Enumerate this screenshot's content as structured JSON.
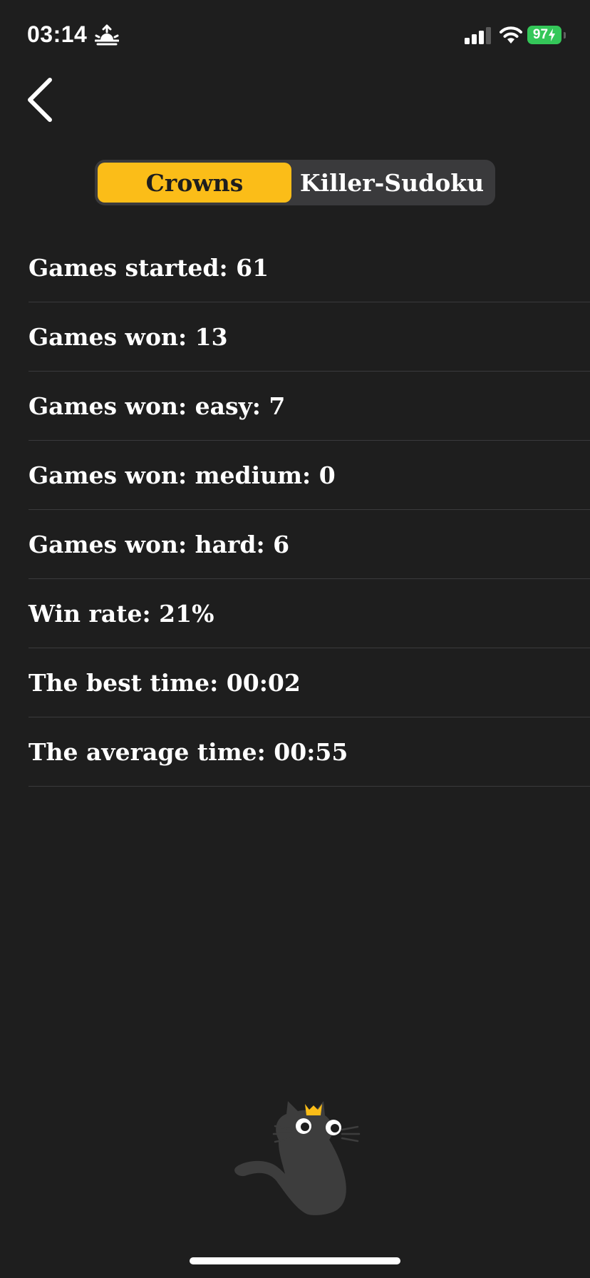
{
  "status_bar": {
    "time": "03:14",
    "battery": "97"
  },
  "tabs": [
    {
      "label": "Crowns",
      "active": true
    },
    {
      "label": "Killer-Sudoku",
      "active": false
    }
  ],
  "stats": [
    "Games started: 61",
    "Games won: 13",
    "Games won: easy: 7",
    "Games won: medium: 0",
    "Games won: hard: 6",
    "Win rate: 21%",
    "The best time: 00:02",
    "The average time: 00:55"
  ],
  "icons": {
    "status_extra": "sunrise-icon",
    "signal": "signal-icon",
    "wifi": "wifi-icon",
    "battery": "battery-charging-icon",
    "back": "chevron-left-icon",
    "mascot": "cat-with-crown-icon"
  },
  "colors": {
    "background": "#1e1e1e",
    "accent": "#fbbd18",
    "segment_bg": "#3a3a3c",
    "battery": "#34c759",
    "divider": "#3a3a3c"
  }
}
